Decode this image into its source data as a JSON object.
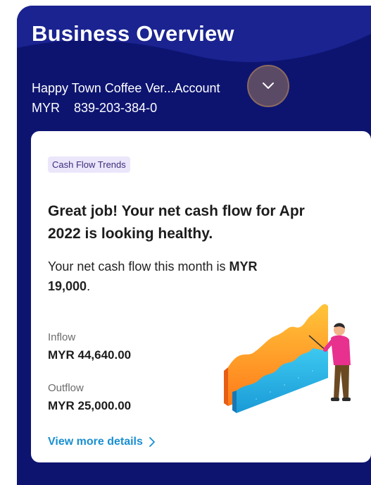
{
  "header": {
    "title": "Business Overview",
    "account_name": "Happy Town Coffee Ver...Account",
    "currency": "MYR",
    "account_number": "839-203-384-0",
    "dropdown_icon": "chevron-down-icon"
  },
  "card": {
    "tag": "Cash Flow Trends",
    "headline": "Great job! Your net cash flow for Apr 2022 is looking healthy.",
    "net_prefix": "Your net cash flow this month is ",
    "net_amount": "MYR 19,000",
    "net_suffix": ".",
    "inflow_label": "Inflow",
    "inflow_value": "MYR 44,640.00",
    "outflow_label": "Outflow",
    "outflow_value": "MYR 25,000.00",
    "details_link": "View more details",
    "link_icon": "chevron-right-icon"
  },
  "colors": {
    "panel_background": "#0d1470",
    "link": "#1a8fd1",
    "tag_background": "#ece6fb"
  }
}
